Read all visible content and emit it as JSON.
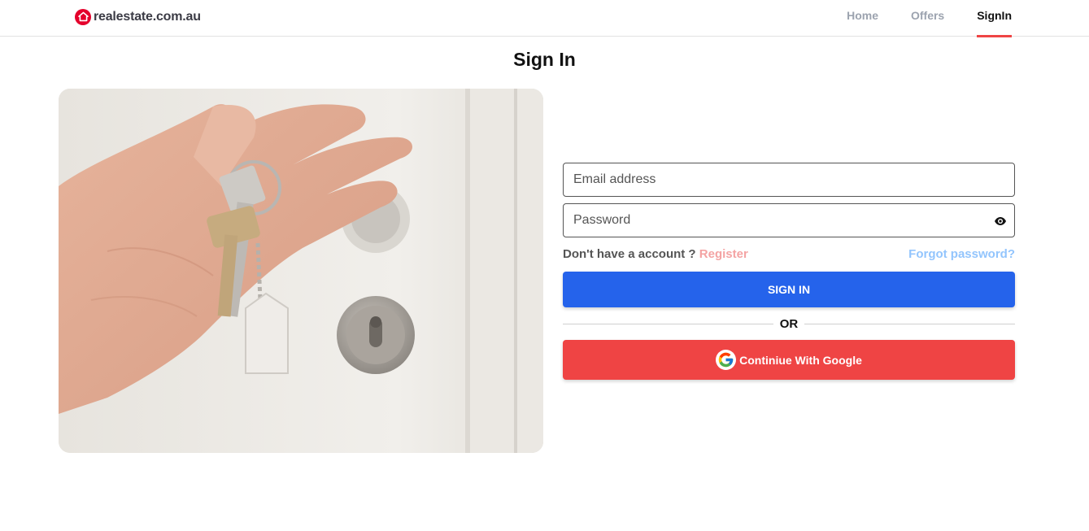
{
  "header": {
    "logo_text": "realestate.com.au",
    "logo_icon": "house-icon",
    "nav": [
      {
        "label": "Home",
        "active": false
      },
      {
        "label": "Offers",
        "active": false
      },
      {
        "label": "SignIn",
        "active": true
      }
    ]
  },
  "page": {
    "title": "Sign In"
  },
  "image": {
    "subject": "hand-holding-keys"
  },
  "form": {
    "email": {
      "placeholder": "Email address",
      "value": ""
    },
    "password": {
      "placeholder": "Password",
      "value": "",
      "toggle_icon": "eye-icon"
    },
    "no_account_text": "Don't have a account ?",
    "register_label": "Register",
    "forgot_label": "Forgot password?",
    "signin_label": "SIGN IN",
    "divider_text": "OR",
    "google_label": "Continiue With Google",
    "google_icon": "google-icon"
  },
  "colors": {
    "brand_red": "#e4002b",
    "accent_red": "#ef4444",
    "primary_blue": "#2563eb",
    "register_pink": "#f4a3a3",
    "forgot_blue": "#93c5fd"
  }
}
